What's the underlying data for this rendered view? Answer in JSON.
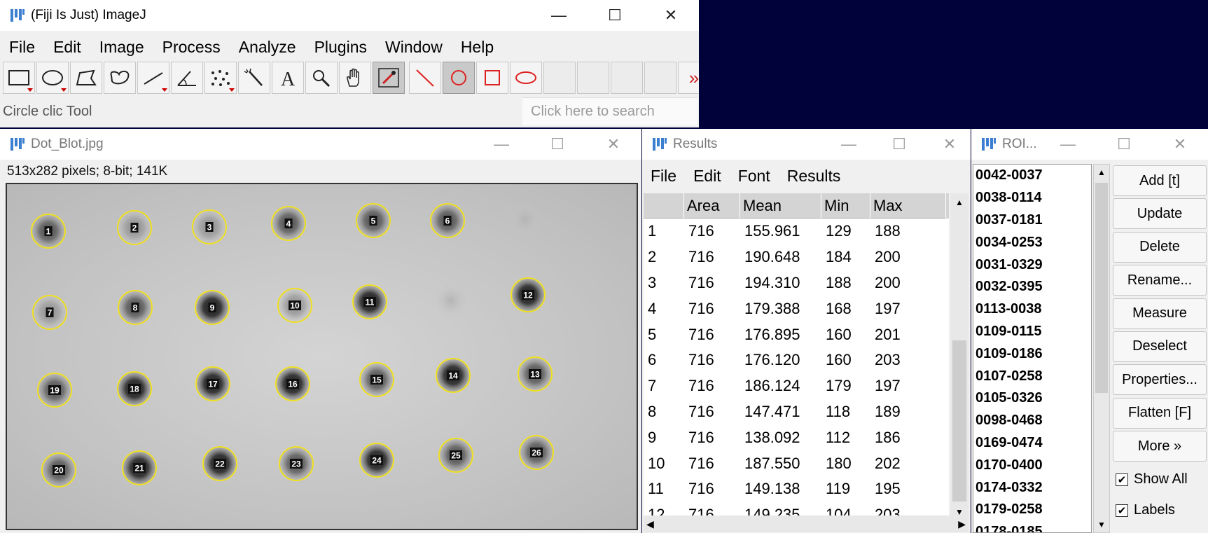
{
  "main": {
    "title": "(Fiji Is Just) ImageJ",
    "menu": [
      "File",
      "Edit",
      "Image",
      "Process",
      "Analyze",
      "Plugins",
      "Window",
      "Help"
    ],
    "status": "Circle clic Tool",
    "search_placeholder": "Click here to search",
    "more_tools": "»",
    "controls": {
      "minimize": "—",
      "maximize": "☐",
      "close": "✕"
    }
  },
  "image_window": {
    "title": "Dot_Blot.jpg",
    "info": "513x282 pixels; 8-bit; 141K",
    "roi_labels": [
      "1",
      "2",
      "3",
      "4",
      "5",
      "6",
      "7",
      "8",
      "9",
      "10",
      "11",
      "12",
      "13",
      "14",
      "15",
      "16",
      "17",
      "18",
      "19",
      "20",
      "21",
      "22",
      "23",
      "24",
      "25",
      "26"
    ]
  },
  "results": {
    "title": "Results",
    "menu": [
      "File",
      "Edit",
      "Font",
      "Results"
    ],
    "columns": [
      "",
      "Area",
      "Mean",
      "Min",
      "Max"
    ],
    "rows": [
      [
        "1",
        "716",
        "155.961",
        "129",
        "188"
      ],
      [
        "2",
        "716",
        "190.648",
        "184",
        "200"
      ],
      [
        "3",
        "716",
        "194.310",
        "188",
        "200"
      ],
      [
        "4",
        "716",
        "179.388",
        "168",
        "197"
      ],
      [
        "5",
        "716",
        "176.895",
        "160",
        "201"
      ],
      [
        "6",
        "716",
        "176.120",
        "160",
        "203"
      ],
      [
        "7",
        "716",
        "186.124",
        "179",
        "197"
      ],
      [
        "8",
        "716",
        "147.471",
        "118",
        "189"
      ],
      [
        "9",
        "716",
        "138.092",
        "112",
        "186"
      ],
      [
        "10",
        "716",
        "187.550",
        "180",
        "202"
      ],
      [
        "11",
        "716",
        "149.138",
        "119",
        "195"
      ],
      [
        "12",
        "716",
        "149.235",
        "104",
        "203"
      ]
    ]
  },
  "roi_manager": {
    "title": "ROI...",
    "items": [
      "0042-0037",
      "0038-0114",
      "0037-0181",
      "0034-0253",
      "0031-0329",
      "0032-0395",
      "0113-0038",
      "0109-0115",
      "0109-0186",
      "0107-0258",
      "0105-0326",
      "0098-0468",
      "0169-0474",
      "0170-0400",
      "0174-0332",
      "0179-0258",
      "0178-0185"
    ],
    "buttons": [
      "Add [t]",
      "Update",
      "Delete",
      "Rename...",
      "Measure",
      "Deselect",
      "Properties...",
      "Flatten [F]",
      "More »"
    ],
    "show_all_label": "Show All",
    "labels_label": "Labels"
  }
}
